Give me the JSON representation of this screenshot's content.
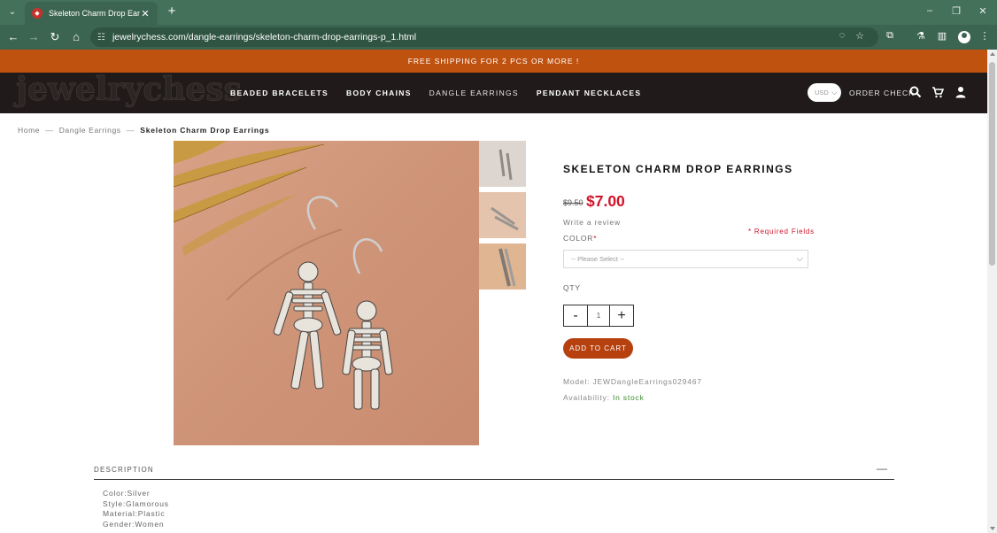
{
  "browser": {
    "tab_title": "Skeleton Charm Drop Earrings",
    "url": "jewelrychess.com/dangle-earrings/skeleton-charm-drop-earrings-p_1.html"
  },
  "promo": {
    "text": "FREE SHIPPING FOR 2 PCS OR MORE !"
  },
  "header": {
    "logo": "jewelrychess",
    "nav": [
      "BEADED BRACELETS",
      "BODY CHAINS",
      "DANGLE EARRINGS",
      "PENDANT NECKLACES"
    ],
    "currency": "USD",
    "order_check": "ORDER CHECK"
  },
  "breadcrumb": {
    "home": "Home",
    "category": "Dangle Earrings",
    "current": "Skeleton Charm Drop Earrings"
  },
  "product": {
    "title": "SKELETON CHARM DROP EARRINGS",
    "old_price": "$9.50",
    "price": "$7.00",
    "write_review": "Write a review",
    "required_fields": "* Required Fields",
    "color_label": "COLOR",
    "color_required": "*",
    "color_placeholder": "-- Please Select --",
    "qty_label": "QTY",
    "qty_minus": "-",
    "qty_value": "1",
    "qty_plus": "+",
    "add_to_cart": "ADD TO CART",
    "model_label": "Model: ",
    "model_value": "JEWDangleEarrings029467",
    "availability_label": "Availability: ",
    "availability_value": "In stock"
  },
  "description": {
    "header": "DESCRIPTION",
    "toggle": "—",
    "lines": [
      "Color:Silver",
      "Style:Glamorous",
      "Material:Plastic",
      "Gender:Women"
    ]
  },
  "colors": {
    "tabbar": "#44715a",
    "toolbar": "#3c6551",
    "promo": "#c0520f",
    "header": "#201b1a",
    "price": "#d0142a",
    "add_to_cart": "#b6400e",
    "in_stock": "#3c8a2e"
  }
}
